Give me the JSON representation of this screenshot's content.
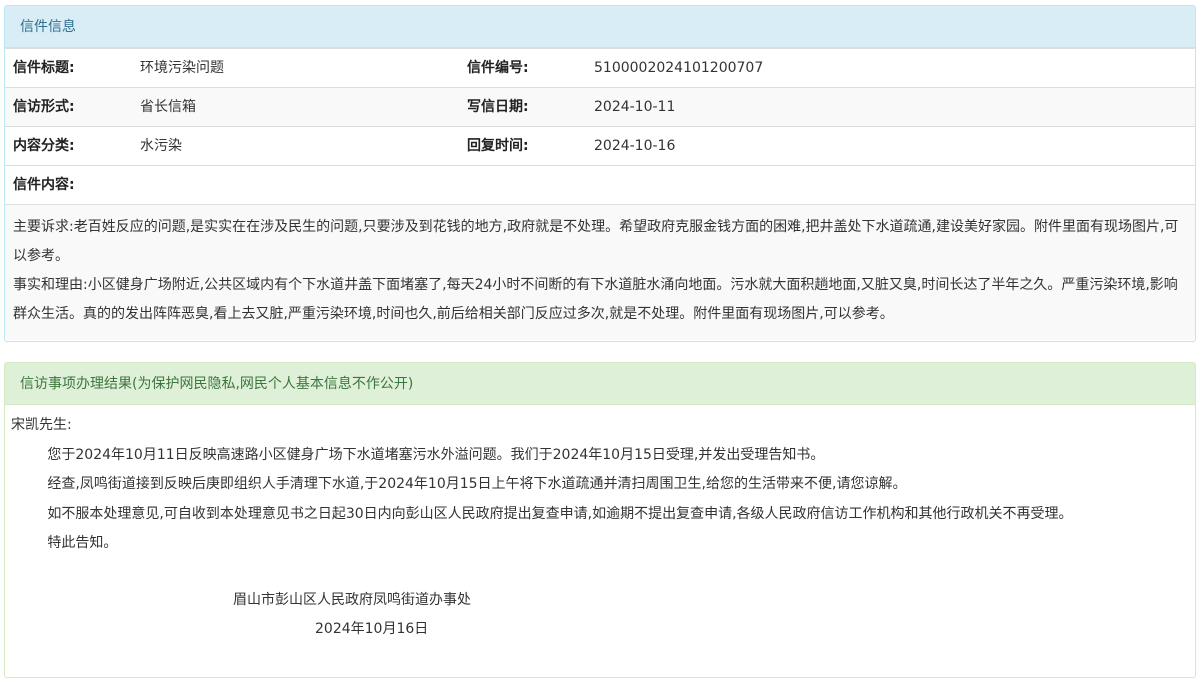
{
  "letter": {
    "heading": "信件信息",
    "rows": [
      {
        "l1": "信件标题:",
        "v1": "环境污染问题",
        "l2": "信件编号:",
        "v2": "5100002024101200707"
      },
      {
        "l1": "信访形式:",
        "v1": "省长信箱",
        "l2": "写信日期:",
        "v2": "2024-10-11"
      },
      {
        "l1": "内容分类:",
        "v1": "水污染",
        "l2": "回复时间:",
        "v2": "2024-10-16"
      }
    ],
    "content_label": "信件内容:",
    "content_paragraphs": [
      "主要诉求:老百姓反应的问题,是实实在在涉及民生的问题,只要涉及到花钱的地方,政府就是不处理。希望政府克服金钱方面的困难,把井盖处下水道疏通,建设美好家园。附件里面有现场图片,可以参考。",
      "事实和理由:小区健身广场附近,公共区域内有个下水道井盖下面堵塞了,每天24小时不间断的有下水道脏水涌向地面。污水就大面积趟地面,又脏又臭,时间长达了半年之久。严重污染环境,影响群众生活。真的的发出阵阵恶臭,看上去又脏,严重污染环境,时间也久,前后给相关部门反应过多次,就是不处理。附件里面有现场图片,可以参考。"
    ]
  },
  "result": {
    "heading": "信访事项办理结果(为保护网民隐私,网民个人基本信息不作公开)",
    "salutation": "宋凯先生:",
    "paragraphs": [
      "您于2024年10月11日反映高速路小区健身广场下水道堵塞污水外溢问题。我们于2024年10月15日受理,并发出受理告知书。",
      "经查,凤鸣街道接到反映后庚即组织人手清理下水道,于2024年10月15日上午将下水道疏通并清扫周围卫生,给您的生活带来不便,请您谅解。",
      "如不服本处理意见,可自收到本处理意见书之日起30日内向彭山区人民政府提出复查申请,如逾期不提出复查申请,各级人民政府信访工作机构和其他行政机关不再受理。",
      "特此告知。"
    ],
    "signature_org": "眉山市彭山区人民政府凤鸣街道办事处",
    "signature_date": "2024年10月16日"
  }
}
